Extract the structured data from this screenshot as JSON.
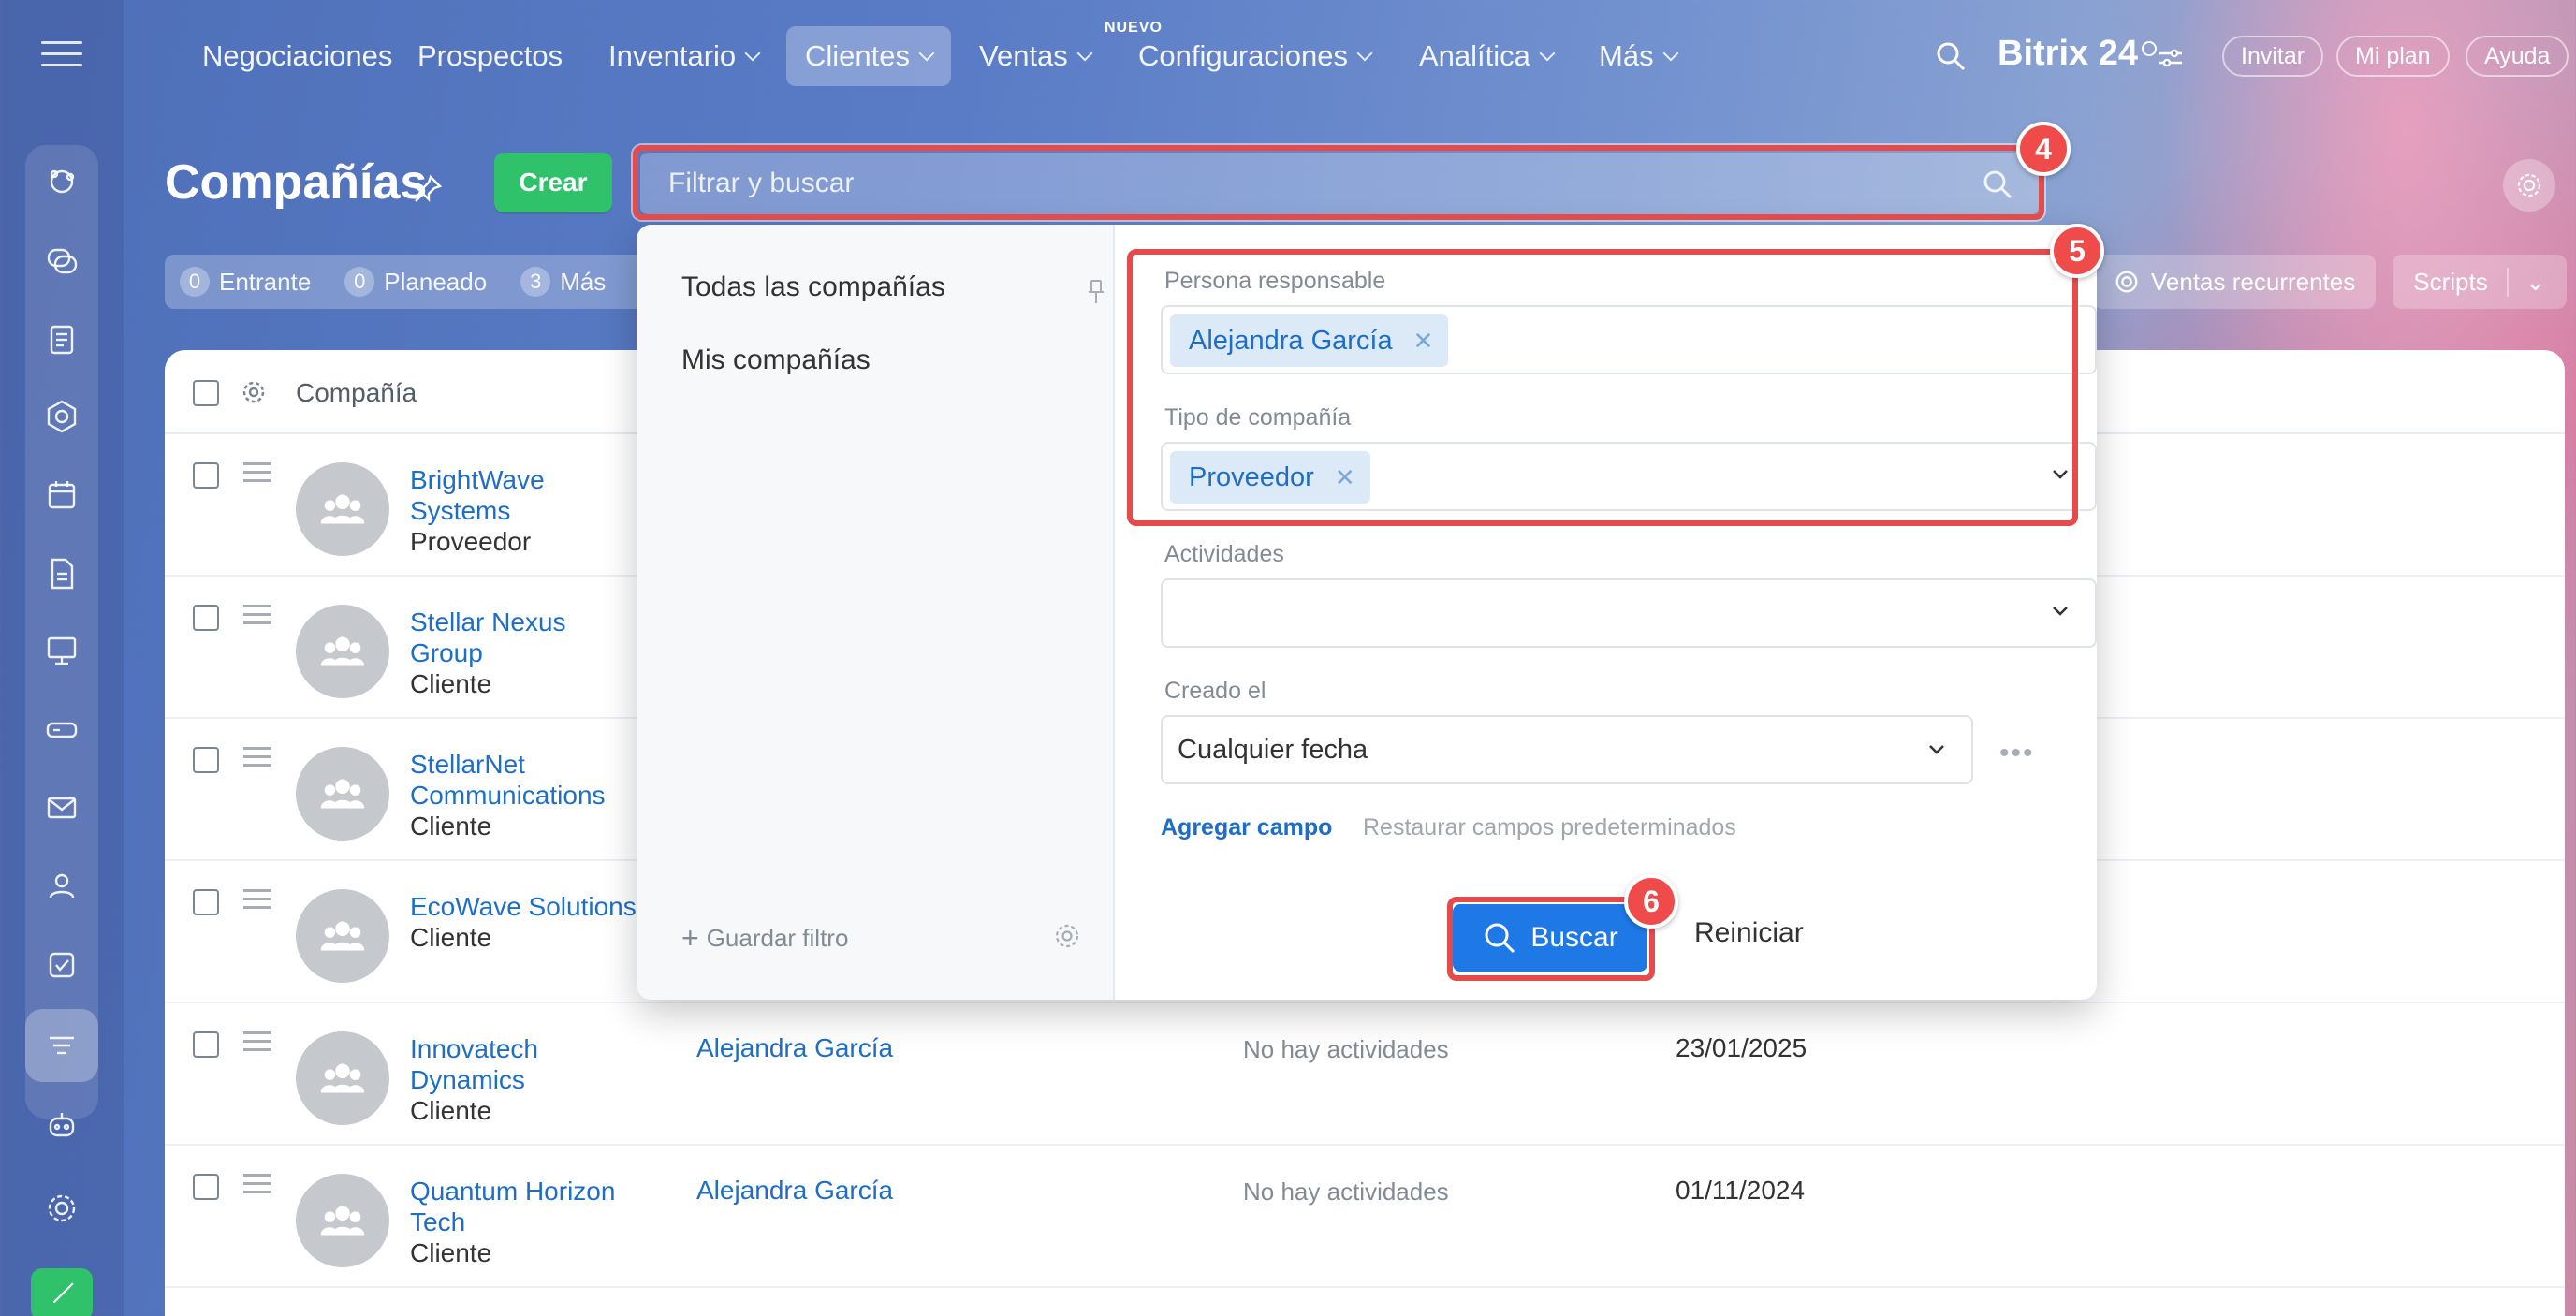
{
  "nav": {
    "items": [
      {
        "label": "Negociaciones",
        "dropdown": false
      },
      {
        "label": "Prospectos",
        "dropdown": false
      },
      {
        "label": "Inventario",
        "dropdown": true
      },
      {
        "label": "Clientes",
        "dropdown": true,
        "active": true
      },
      {
        "label": "Ventas",
        "dropdown": true,
        "badge": "NUEVO"
      },
      {
        "label": "Configuraciones",
        "dropdown": true
      },
      {
        "label": "Analítica",
        "dropdown": true
      },
      {
        "label": "Más",
        "dropdown": true
      }
    ],
    "brand": "Bitrix 24",
    "buttons": {
      "invite": "Invitar",
      "plan": "Mi plan",
      "help": "Ayuda"
    }
  },
  "page": {
    "title": "Compañías",
    "create_label": "Crear",
    "search_placeholder": "Filtrar y buscar"
  },
  "counters": [
    {
      "num": "0",
      "label": "Entrante"
    },
    {
      "num": "0",
      "label": "Planeado"
    },
    {
      "num": "3",
      "label": "Más"
    }
  ],
  "tools": {
    "recurring": "Ventas recurrentes",
    "scripts": "Scripts"
  },
  "table": {
    "header_company": "Compañía",
    "rows": [
      {
        "name": "BrightWave Systems",
        "type": "Proveedor",
        "responsible": "",
        "activity": "",
        "date": ""
      },
      {
        "name": "Stellar Nexus Group",
        "type": "Cliente",
        "responsible": "",
        "activity": "",
        "date": ""
      },
      {
        "name": "StellarNet Communications",
        "type": "Cliente",
        "responsible": "",
        "activity": "",
        "date": ""
      },
      {
        "name": "EcoWave Solutions",
        "type": "Cliente",
        "responsible": "",
        "activity": "",
        "date": ""
      },
      {
        "name": "Innovatech Dynamics",
        "type": "Cliente",
        "responsible": "Alejandra García",
        "activity": "No hay actividades",
        "date": "23/01/2025"
      },
      {
        "name": "Quantum Horizon Tech",
        "type": "Cliente",
        "responsible": "Alejandra García",
        "activity": "No hay actividades",
        "date": "01/11/2024"
      }
    ]
  },
  "filter": {
    "presets": [
      "Todas las compañías",
      "Mis compañías"
    ],
    "save_filter": "Guardar filtro",
    "fields": {
      "responsible_label": "Persona responsable",
      "responsible_value": "Alejandra García",
      "company_type_label": "Tipo de compañía",
      "company_type_value": "Proveedor",
      "activities_label": "Actividades",
      "created_label": "Creado el",
      "created_value": "Cualquier fecha"
    },
    "add_field": "Agregar campo",
    "restore_fields": "Restaurar campos predeterminados",
    "search_button": "Buscar",
    "reset_button": "Reiniciar"
  },
  "annotations": {
    "step4": "4",
    "step5": "5",
    "step6": "6",
    "color": "#e64b4b"
  }
}
